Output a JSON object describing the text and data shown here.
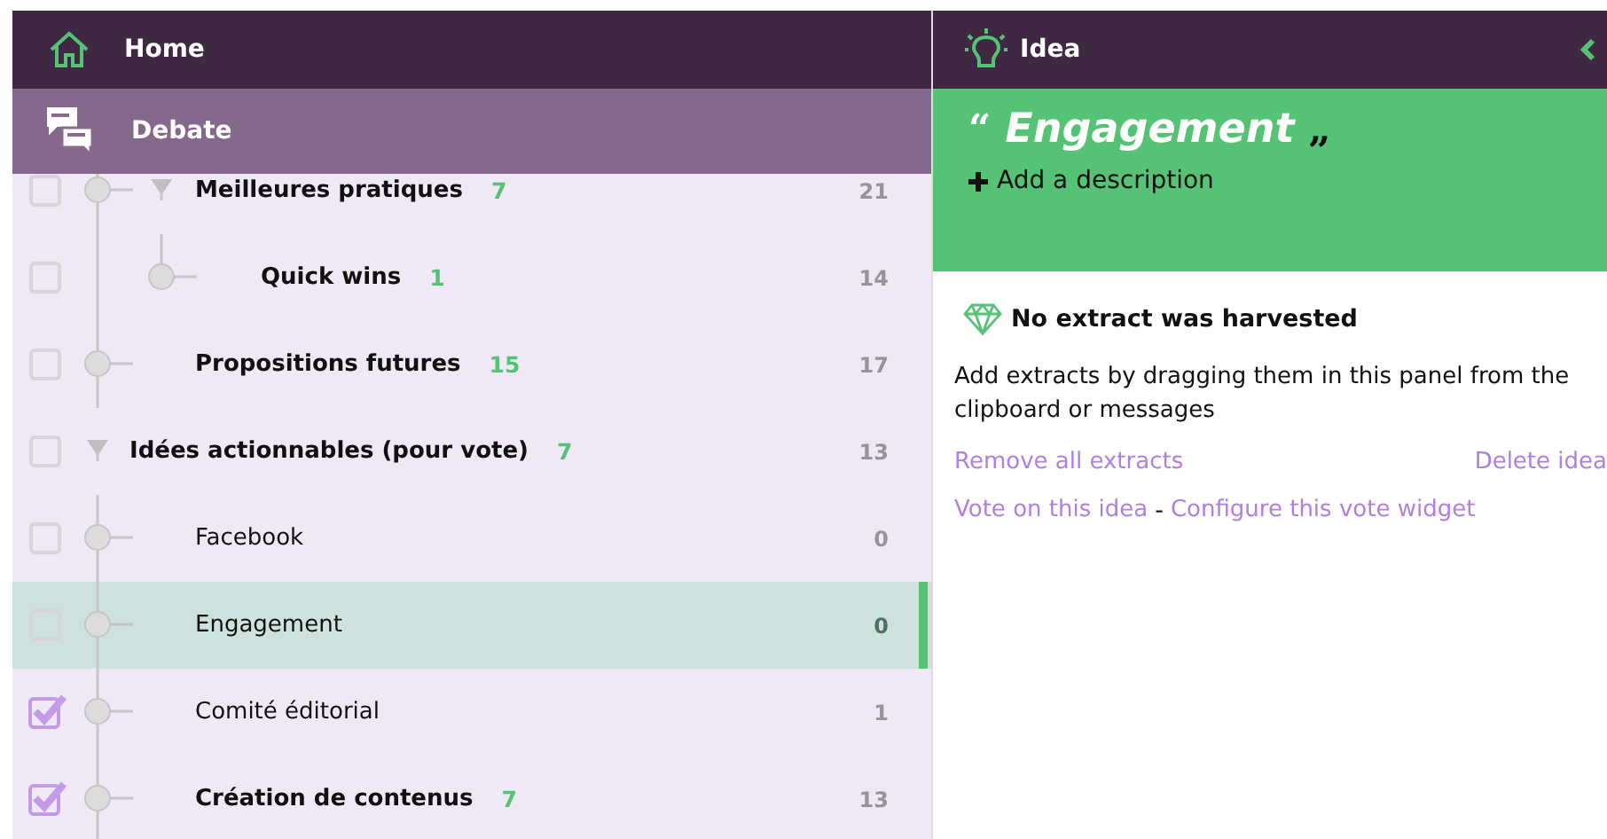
{
  "nav": {
    "home": "Home",
    "debate": "Debate"
  },
  "idea_tree": [
    {
      "children": [
        {
          "label": "Meilleures pratiques",
          "count": "7",
          "total": "21",
          "checked": false,
          "selected": false,
          "expanded": true,
          "children": [
            {
              "label": "Quick wins",
              "count": "1",
              "total": "14",
              "checked": false,
              "selected": false
            }
          ]
        },
        {
          "label": "Propositions futures",
          "count": "15",
          "total": "17",
          "checked": false,
          "selected": false
        }
      ]
    },
    {
      "label": "Idées actionnables (pour vote)",
      "count": "7",
      "total": "13",
      "checked": false,
      "selected": false,
      "expanded": true,
      "children": [
        {
          "label": "Facebook",
          "total": "0",
          "checked": false,
          "selected": false
        },
        {
          "label": "Engagement",
          "total": "0",
          "checked": false,
          "selected": true
        },
        {
          "label": "Comité éditorial",
          "total": "1",
          "checked": true,
          "selected": false
        },
        {
          "label": "Création de contenus",
          "count": "7",
          "total": "13",
          "checked": true,
          "selected": false
        }
      ]
    }
  ],
  "idea_panel": {
    "header": "Idea",
    "open_quote": "“",
    "title": "Engagement",
    "close_quote": "„",
    "add_description": "Add a description",
    "empty_title": "No extract was harvested",
    "empty_text": "Add extracts by dragging them in this panel from the clipboard or messages",
    "remove_link": "Remove all extracts",
    "delete_link": "Delete idea",
    "vote_link": "Vote on this idea",
    "separator": "-",
    "configure_link": "Configure this vote widget"
  }
}
